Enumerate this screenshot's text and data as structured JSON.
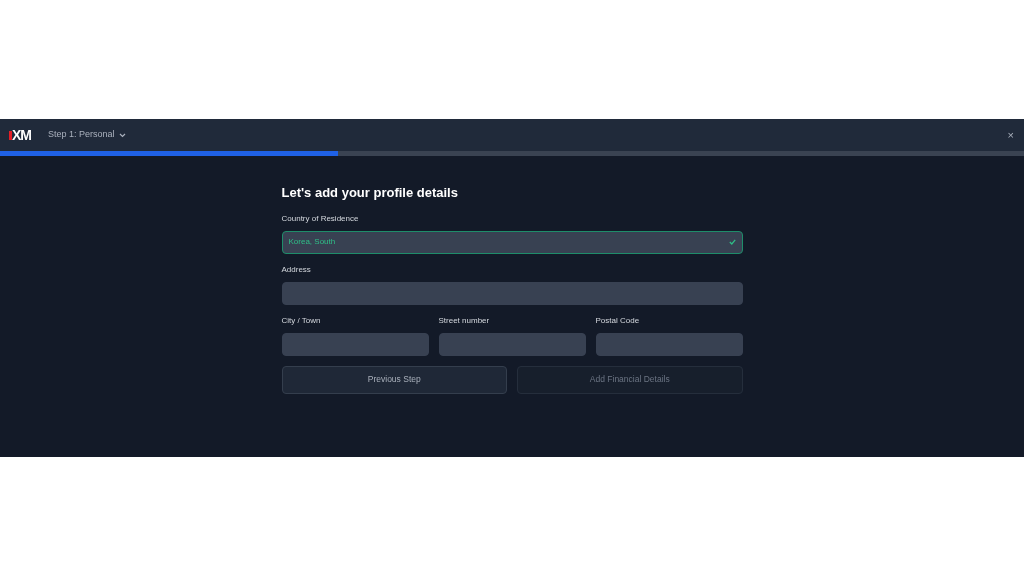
{
  "header": {
    "logo": "XM",
    "step_menu": "Step 1: Personal",
    "close": "×"
  },
  "progress": {
    "level": 0.33
  },
  "form": {
    "title": "Let's add your profile details",
    "rows": [
      [
        {
          "label": "Country of Residence",
          "value": "Korea, South",
          "valid": true
        }
      ],
      [
        {
          "label": "Address",
          "valid": false
        }
      ],
      [
        {
          "label": "City / Town",
          "valid": false
        },
        {
          "label": "Street number",
          "valid": false
        },
        {
          "label": "Postal Code",
          "valid": false
        }
      ]
    ],
    "buttons": [
      {
        "label": "Previous Step",
        "disabled": false
      },
      {
        "label": "Add Financial Details",
        "disabled": true
      }
    ]
  }
}
